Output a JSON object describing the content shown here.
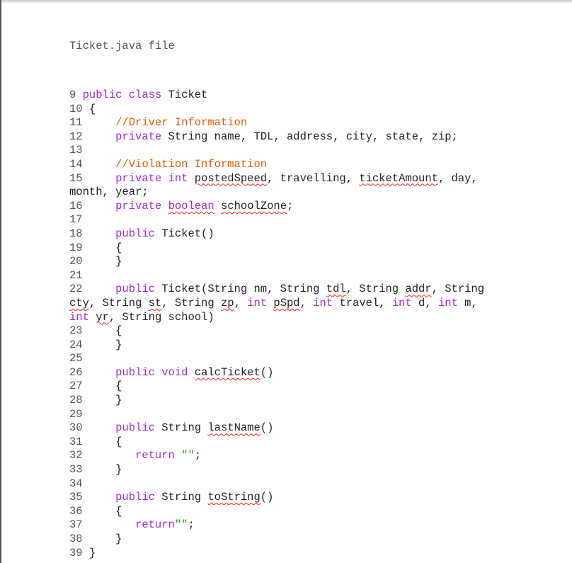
{
  "document": {
    "title": "Ticket.java file",
    "colors": {
      "keyword": "#9a2bd6",
      "comment": "#e05a00",
      "string": "#2a9a2a",
      "line_number": "#555555",
      "spellcheck_squiggle": "#ff2020"
    },
    "lines": [
      {
        "num": "9",
        "pad": " ",
        "tokens": [
          {
            "t": "public class",
            "c": "kw"
          },
          {
            "t": " Ticket",
            "c": "pl"
          }
        ]
      },
      {
        "num": "10",
        "pad": " ",
        "tokens": [
          {
            "t": "{",
            "c": "pl"
          }
        ]
      },
      {
        "num": "11",
        "pad": "     ",
        "tokens": [
          {
            "t": "//Driver Information",
            "c": "cm"
          }
        ]
      },
      {
        "num": "12",
        "pad": "     ",
        "tokens": [
          {
            "t": "private",
            "c": "kw"
          },
          {
            "t": " String name, TDL, address, city, state, zip;",
            "c": "pl"
          }
        ]
      },
      {
        "num": "13",
        "pad": "",
        "tokens": []
      },
      {
        "num": "14",
        "pad": "     ",
        "tokens": [
          {
            "t": "//Violation Information",
            "c": "cm"
          }
        ]
      },
      {
        "num": "15",
        "pad": "     ",
        "tokens": [
          {
            "t": "private int",
            "c": "kw"
          },
          {
            "t": " ",
            "c": "pl"
          },
          {
            "t": "postedSpeed",
            "c": "pl",
            "sq": true
          },
          {
            "t": ", travelling, ",
            "c": "pl"
          },
          {
            "t": "ticketAmount",
            "c": "pl",
            "sq": true
          },
          {
            "t": ", day, month, year;",
            "c": "pl"
          }
        ]
      },
      {
        "num": "16",
        "pad": "     ",
        "tokens": [
          {
            "t": "private",
            "c": "kw"
          },
          {
            "t": " ",
            "c": "pl"
          },
          {
            "t": "boolean",
            "c": "kw",
            "sq": true
          },
          {
            "t": " ",
            "c": "pl"
          },
          {
            "t": "schoolZone",
            "c": "pl",
            "sq": true
          },
          {
            "t": ";",
            "c": "pl"
          }
        ]
      },
      {
        "num": "17",
        "pad": "",
        "tokens": []
      },
      {
        "num": "18",
        "pad": "     ",
        "tokens": [
          {
            "t": "public",
            "c": "kw"
          },
          {
            "t": " Ticket()",
            "c": "pl"
          }
        ]
      },
      {
        "num": "19",
        "pad": "     ",
        "tokens": [
          {
            "t": "{",
            "c": "pl"
          }
        ]
      },
      {
        "num": "20",
        "pad": "     ",
        "tokens": [
          {
            "t": "}",
            "c": "pl"
          }
        ]
      },
      {
        "num": "21",
        "pad": "",
        "tokens": []
      },
      {
        "num": "22",
        "pad": "     ",
        "tokens": [
          {
            "t": "public",
            "c": "kw"
          },
          {
            "t": " Ticket(String nm, String ",
            "c": "pl"
          },
          {
            "t": "tdl",
            "c": "pl",
            "sq": true
          },
          {
            "t": ", String ",
            "c": "pl"
          },
          {
            "t": "addr",
            "c": "pl",
            "sq": true
          },
          {
            "t": ", String ",
            "c": "pl"
          },
          {
            "t": "cty",
            "c": "pl",
            "sq": true
          },
          {
            "t": ", String ",
            "c": "pl"
          },
          {
            "t": "st",
            "c": "pl",
            "sq": true
          },
          {
            "t": ", String ",
            "c": "pl"
          },
          {
            "t": "zp",
            "c": "pl",
            "sq": true
          },
          {
            "t": ", ",
            "c": "pl"
          },
          {
            "t": "int",
            "c": "kw"
          },
          {
            "t": " ",
            "c": "pl"
          },
          {
            "t": "pSpd",
            "c": "pl",
            "sq": true
          },
          {
            "t": ", ",
            "c": "pl"
          },
          {
            "t": "int",
            "c": "kw"
          },
          {
            "t": " travel, ",
            "c": "pl"
          },
          {
            "t": "int",
            "c": "kw"
          },
          {
            "t": " d, ",
            "c": "pl"
          },
          {
            "t": "int",
            "c": "kw"
          },
          {
            "t": " m, ",
            "c": "pl"
          },
          {
            "t": "int",
            "c": "kw"
          },
          {
            "t": " ",
            "c": "pl"
          },
          {
            "t": "yr",
            "c": "pl",
            "sq": true
          },
          {
            "t": ", String school)",
            "c": "pl"
          }
        ]
      },
      {
        "num": "23",
        "pad": "     ",
        "tokens": [
          {
            "t": "{",
            "c": "pl"
          }
        ]
      },
      {
        "num": "24",
        "pad": "     ",
        "tokens": [
          {
            "t": "}",
            "c": "pl"
          }
        ]
      },
      {
        "num": "25",
        "pad": "",
        "tokens": []
      },
      {
        "num": "26",
        "pad": "     ",
        "tokens": [
          {
            "t": "public void",
            "c": "kw"
          },
          {
            "t": " ",
            "c": "pl"
          },
          {
            "t": "calcTicket",
            "c": "pl",
            "sq": true
          },
          {
            "t": "()",
            "c": "pl"
          }
        ]
      },
      {
        "num": "27",
        "pad": "     ",
        "tokens": [
          {
            "t": "{",
            "c": "pl"
          }
        ]
      },
      {
        "num": "28",
        "pad": "     ",
        "tokens": [
          {
            "t": "}",
            "c": "pl"
          }
        ]
      },
      {
        "num": "29",
        "pad": "",
        "tokens": []
      },
      {
        "num": "30",
        "pad": "     ",
        "tokens": [
          {
            "t": "public",
            "c": "kw"
          },
          {
            "t": " String ",
            "c": "pl"
          },
          {
            "t": "lastName",
            "c": "pl",
            "sq": true
          },
          {
            "t": "()",
            "c": "pl"
          }
        ]
      },
      {
        "num": "31",
        "pad": "     ",
        "tokens": [
          {
            "t": "{",
            "c": "pl"
          }
        ]
      },
      {
        "num": "32",
        "pad": "        ",
        "tokens": [
          {
            "t": "return",
            "c": "kw"
          },
          {
            "t": " ",
            "c": "pl"
          },
          {
            "t": "\"\"",
            "c": "st"
          },
          {
            "t": ";",
            "c": "pl"
          }
        ]
      },
      {
        "num": "33",
        "pad": "     ",
        "tokens": [
          {
            "t": "}",
            "c": "pl"
          }
        ]
      },
      {
        "num": "34",
        "pad": "",
        "tokens": []
      },
      {
        "num": "35",
        "pad": "     ",
        "tokens": [
          {
            "t": "public",
            "c": "kw"
          },
          {
            "t": " String ",
            "c": "pl"
          },
          {
            "t": "toString",
            "c": "pl",
            "sq": true
          },
          {
            "t": "()",
            "c": "pl"
          }
        ]
      },
      {
        "num": "36",
        "pad": "     ",
        "tokens": [
          {
            "t": "{",
            "c": "pl"
          }
        ]
      },
      {
        "num": "37",
        "pad": "        ",
        "tokens": [
          {
            "t": "return",
            "c": "kw"
          },
          {
            "t": "\"\"",
            "c": "st"
          },
          {
            "t": ";",
            "c": "pl"
          }
        ]
      },
      {
        "num": "38",
        "pad": "     ",
        "tokens": [
          {
            "t": "}",
            "c": "pl"
          }
        ]
      },
      {
        "num": "39",
        "pad": " ",
        "tokens": [
          {
            "t": "}",
            "c": "pl"
          }
        ]
      }
    ]
  }
}
